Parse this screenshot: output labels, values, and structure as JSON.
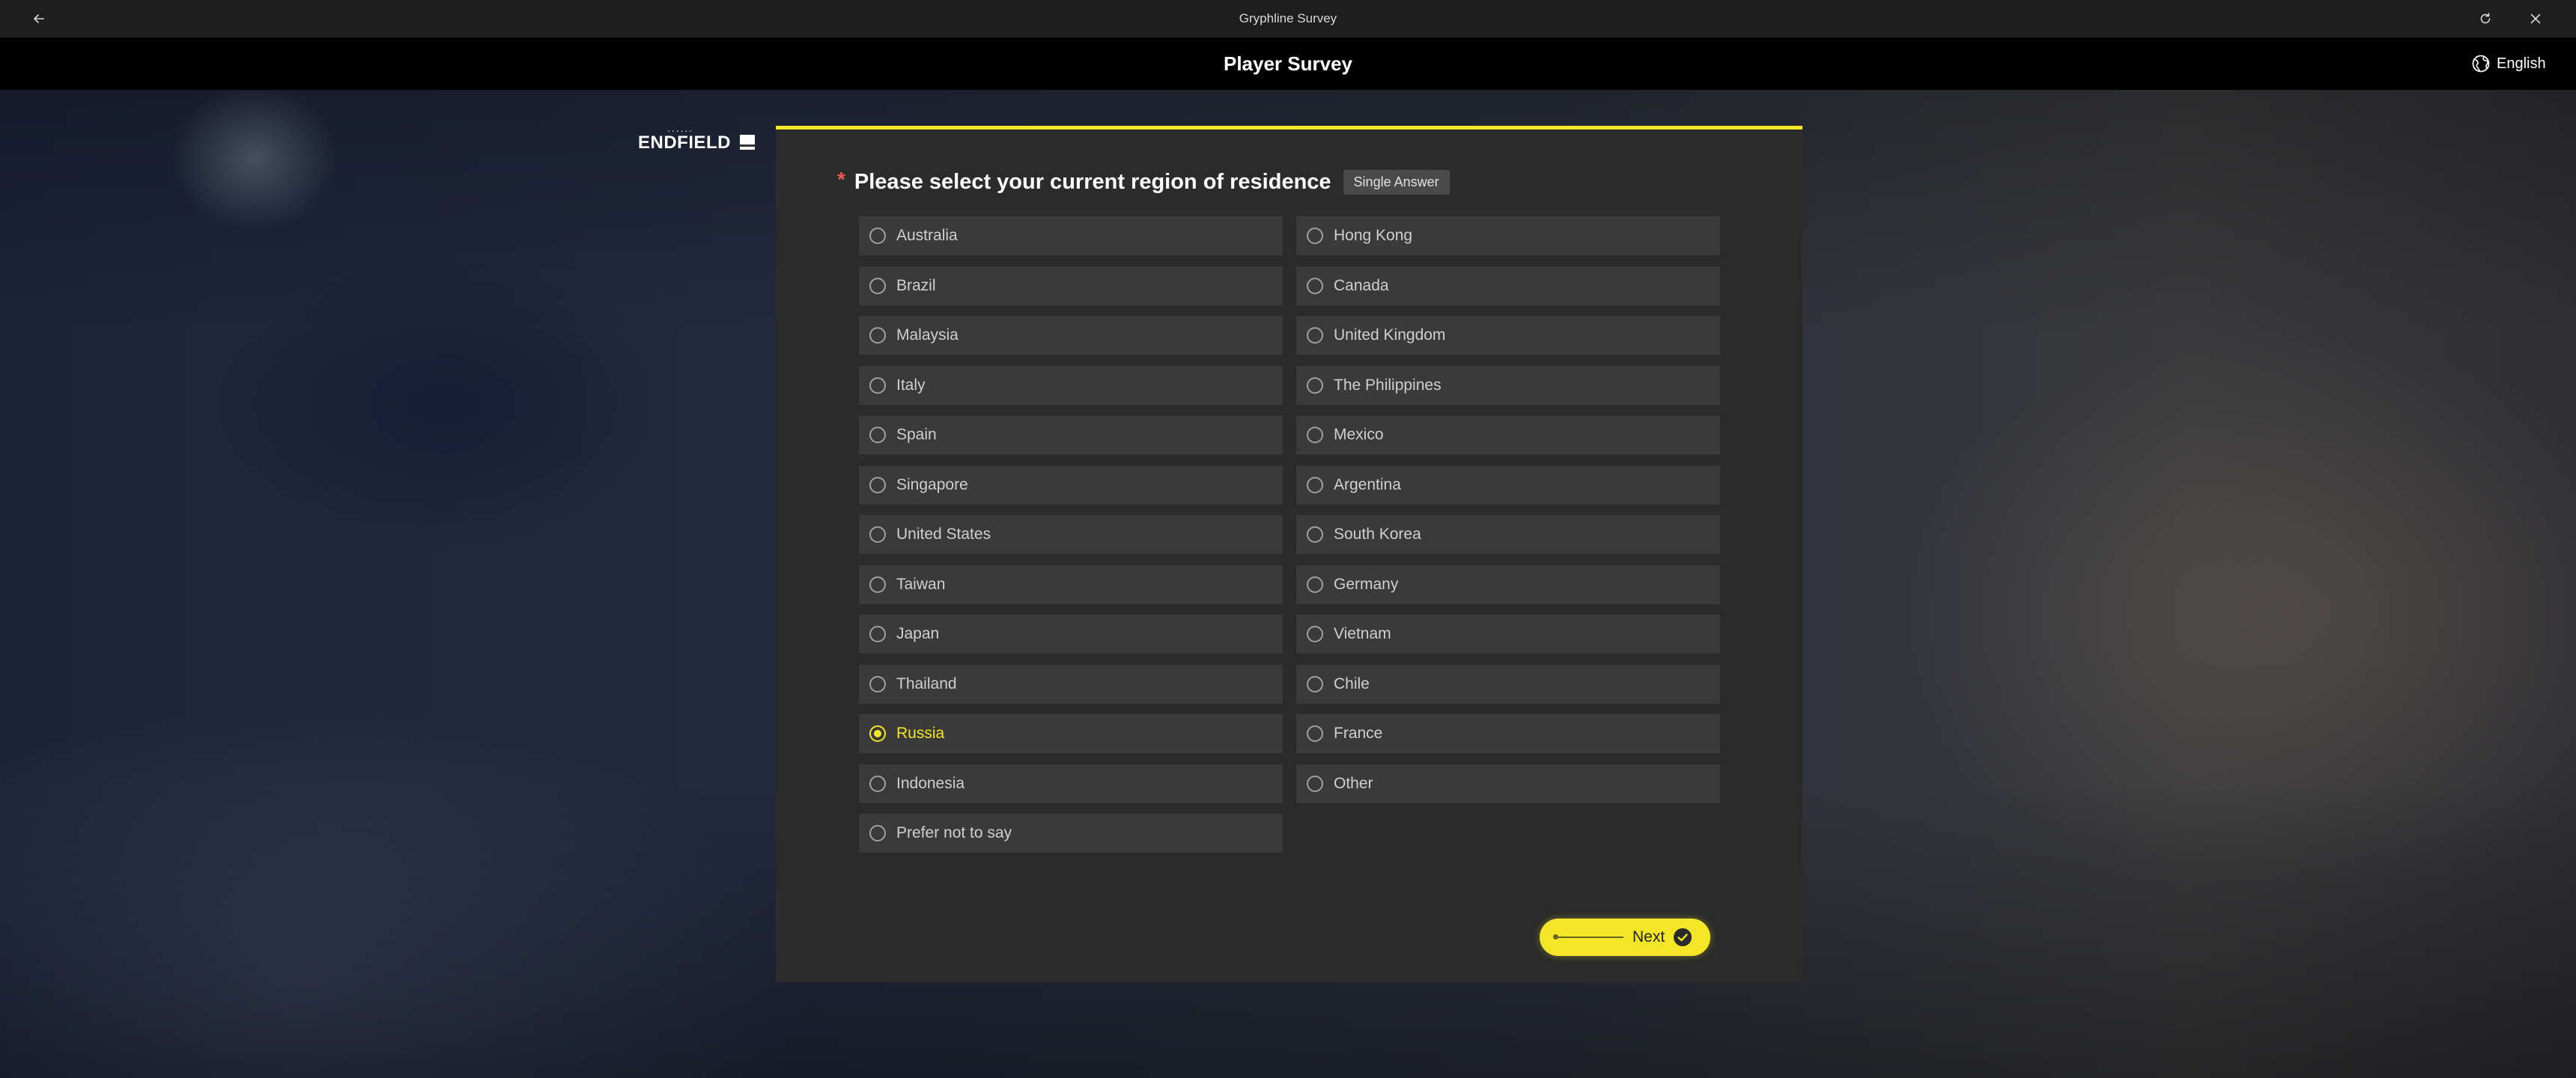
{
  "window": {
    "title": "Gryphline Survey"
  },
  "header": {
    "title": "Player Survey",
    "language": "English"
  },
  "logo": {
    "text": "ENDFIELD"
  },
  "question": {
    "required_marker": "*",
    "text": "Please select your current region of residence",
    "type_badge": "Single Answer",
    "selected": "Russia",
    "options": [
      {
        "label": "Australia",
        "selected": false
      },
      {
        "label": "Hong Kong",
        "selected": false
      },
      {
        "label": "Brazil",
        "selected": false
      },
      {
        "label": "Canada",
        "selected": false
      },
      {
        "label": "Malaysia",
        "selected": false
      },
      {
        "label": "United Kingdom",
        "selected": false
      },
      {
        "label": "Italy",
        "selected": false
      },
      {
        "label": "The Philippines",
        "selected": false
      },
      {
        "label": "Spain",
        "selected": false
      },
      {
        "label": "Mexico",
        "selected": false
      },
      {
        "label": "Singapore",
        "selected": false
      },
      {
        "label": "Argentina",
        "selected": false
      },
      {
        "label": "United States",
        "selected": false
      },
      {
        "label": "South Korea",
        "selected": false
      },
      {
        "label": "Taiwan",
        "selected": false
      },
      {
        "label": "Germany",
        "selected": false
      },
      {
        "label": "Japan",
        "selected": false
      },
      {
        "label": "Vietnam",
        "selected": false
      },
      {
        "label": "Thailand",
        "selected": false
      },
      {
        "label": "Chile",
        "selected": false
      },
      {
        "label": "Russia",
        "selected": true
      },
      {
        "label": "France",
        "selected": false
      },
      {
        "label": "Indonesia",
        "selected": false
      },
      {
        "label": "Other",
        "selected": false
      },
      {
        "label": "Prefer not to say",
        "selected": false
      }
    ]
  },
  "next_button": {
    "label": "Next",
    "icon": "check-circle-icon"
  },
  "icons": {
    "back": "arrow-left-icon",
    "refresh": "refresh-icon",
    "close": "close-icon",
    "language": "globe-icon"
  },
  "colors": {
    "accent": "#f3e629",
    "required": "#e05a4e",
    "panel": "#2b2b2b",
    "option_bg": "#3a3a3a",
    "titlebar": "#1e1e1e",
    "header": "#000000"
  }
}
